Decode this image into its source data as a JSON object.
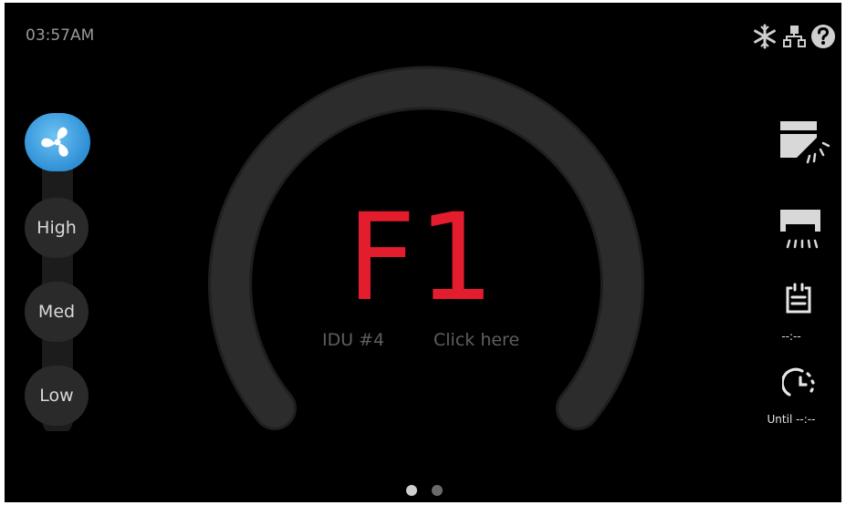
{
  "status_bar": {
    "time": "03:57AM",
    "icons": [
      "snowflake-icon",
      "network-icon",
      "help-icon"
    ]
  },
  "main": {
    "error_code": "F1",
    "unit_label": "IDU #4",
    "action_label": "Click here"
  },
  "fan": {
    "icon": "fan-icon",
    "speeds": [
      "High",
      "Med",
      "Low"
    ]
  },
  "right_panel": {
    "items": [
      {
        "icon": "swing-horizontal-icon"
      },
      {
        "icon": "swing-vertical-icon"
      },
      {
        "icon": "schedule-icon",
        "text": "--:--"
      },
      {
        "icon": "timer-icon",
        "text": "Until --:--"
      }
    ]
  },
  "pager": {
    "pages": 2,
    "active": 1
  },
  "colors": {
    "error": "#e31d2d",
    "fan_active": "#3a9be0",
    "track": "#2b2b2b"
  }
}
